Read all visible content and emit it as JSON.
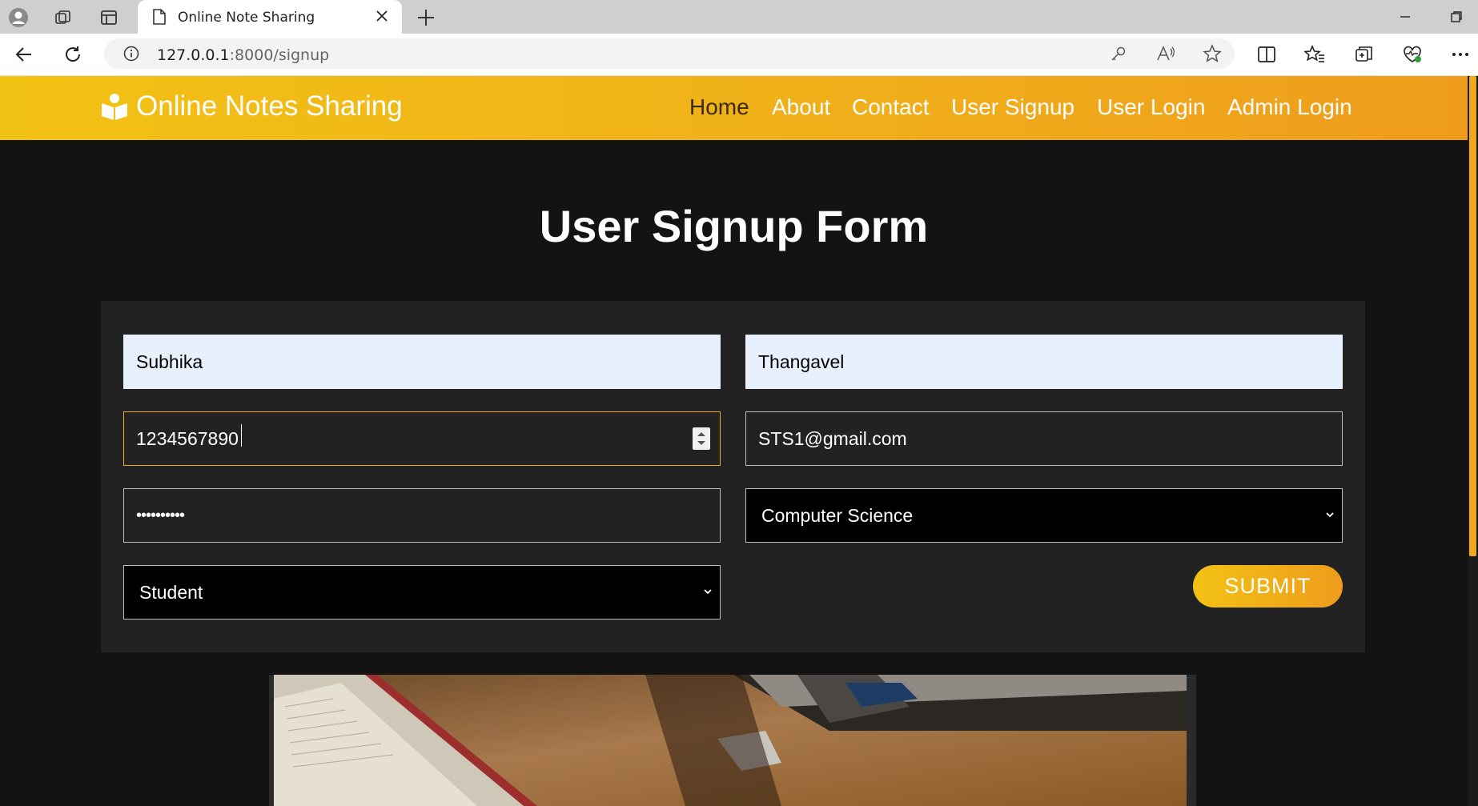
{
  "browser": {
    "tab_title": "Online Note Sharing",
    "url_host": "127.0.0.1",
    "url_rest": ":8000/signup"
  },
  "site": {
    "brand": "Online Notes Sharing",
    "nav": [
      "Home",
      "About",
      "Contact",
      "User Signup",
      "User Login",
      "Admin Login"
    ],
    "active_nav": "Home",
    "accent_colors": [
      "#f2c214",
      "#ef9c1c"
    ]
  },
  "form": {
    "title": "User Signup Form",
    "first_name": "Subhika",
    "last_name": "Thangavel",
    "contact": "1234567890",
    "email": "STS1@gmail.com",
    "password": "••••••••••",
    "branch": "Computer Science",
    "role": "Student",
    "submit_label": "SUBMIT"
  }
}
